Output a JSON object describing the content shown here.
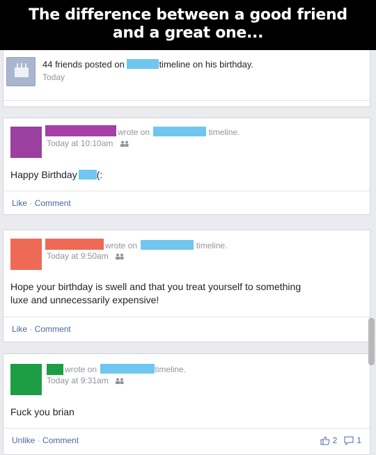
{
  "caption": {
    "line1": "The difference between a good friend",
    "line2": "and a great one..."
  },
  "birthday": {
    "text_prefix": "44 friends posted on",
    "text_suffix": "timeline on his birthday.",
    "time": "Today",
    "icon": "birthday-cake-icon"
  },
  "posts": [
    {
      "avatar_color": "#9b3fa1",
      "name_color": "#a63fa8",
      "wrote_on": "wrote on",
      "timeline": "timeline.",
      "time": "Today at 10:10am",
      "body_prefix": "Happy Birthday",
      "body_suffix": "(:",
      "actions": {
        "like": "Like",
        "sep": "·",
        "comment": "Comment"
      }
    },
    {
      "avatar_color": "#ef6a54",
      "name_color": "#ee6a55",
      "wrote_on": "wrote on",
      "timeline": "timeline.",
      "time": "Today at 9:50am",
      "body_line1": "Hope your birthday is swell and that you treat yourself to something",
      "body_line2": "luxe and unnecessarily expensive!",
      "actions": {
        "like": "Like",
        "sep": "·",
        "comment": "Comment"
      }
    },
    {
      "avatar_color": "#1e9e44",
      "name_color": "#1e9e44",
      "wrote_on": "wrote on",
      "timeline": "timeline.",
      "time": "Today at 9:31am",
      "body": "Fuck you brian",
      "actions": {
        "like": "Unlike",
        "sep": "·",
        "comment": "Comment"
      },
      "likes_count": "2",
      "comments_count": "1"
    }
  ],
  "colors": {
    "redaction": "#6fc6ee",
    "link": "#4b67a1",
    "meta": "#90949c"
  }
}
